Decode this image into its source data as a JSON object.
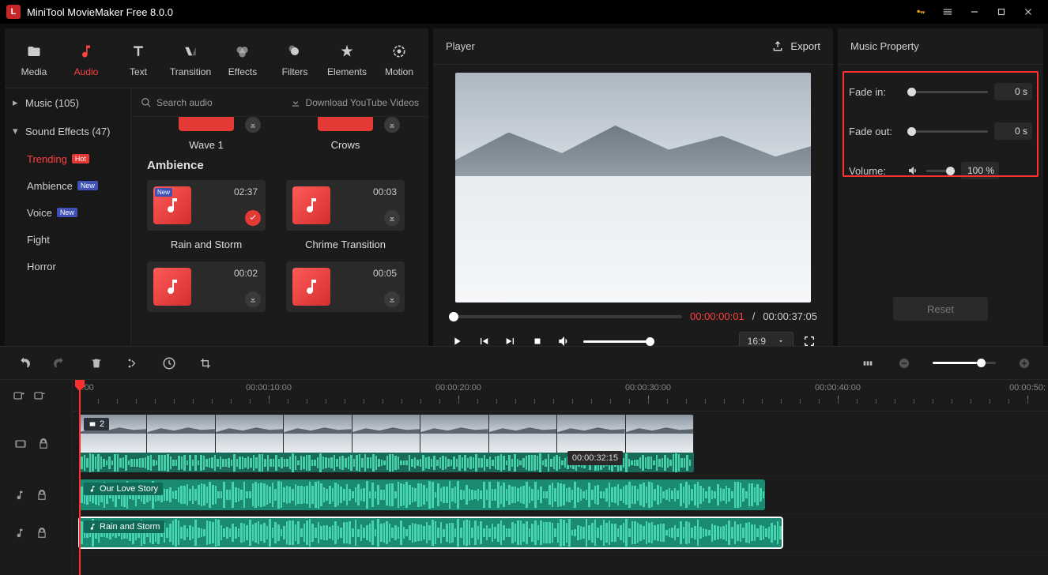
{
  "app": {
    "title": "MiniTool MovieMaker Free 8.0.0"
  },
  "tool_tabs": [
    {
      "id": "media",
      "label": "Media"
    },
    {
      "id": "audio",
      "label": "Audio"
    },
    {
      "id": "text",
      "label": "Text"
    },
    {
      "id": "transition",
      "label": "Transition"
    },
    {
      "id": "effects",
      "label": "Effects"
    },
    {
      "id": "filters",
      "label": "Filters"
    },
    {
      "id": "elements",
      "label": "Elements"
    },
    {
      "id": "motion",
      "label": "Motion"
    }
  ],
  "library": {
    "search_placeholder": "Search audio",
    "youtube_link": "Download YouTube Videos",
    "sections": {
      "music": "Music (105)",
      "sound_effects": "Sound Effects (47)"
    },
    "categories": [
      {
        "id": "trending",
        "label": "Trending",
        "badge": "Hot"
      },
      {
        "id": "ambience",
        "label": "Ambience",
        "badge": "New"
      },
      {
        "id": "voice",
        "label": "Voice",
        "badge": "New"
      },
      {
        "id": "fight",
        "label": "Fight"
      },
      {
        "id": "horror",
        "label": "Horror"
      }
    ],
    "partial_row": [
      {
        "name": "Wave 1"
      },
      {
        "name": "Crows"
      }
    ],
    "group_title": "Ambience",
    "items_row1": [
      {
        "name": "Rain and Storm",
        "duration": "02:37",
        "new": true,
        "checked": true
      },
      {
        "name": "Chrime Transition",
        "duration": "00:03"
      }
    ],
    "items_row2": [
      {
        "name": "",
        "duration": "00:02"
      },
      {
        "name": "",
        "duration": "00:05"
      }
    ]
  },
  "player": {
    "title": "Player",
    "export": "Export",
    "current": "00:00:00:01",
    "total": "00:00:37:05",
    "aspect": "16:9"
  },
  "property": {
    "title": "Music Property",
    "fade_in_label": "Fade in:",
    "fade_in_value": "0 s",
    "fade_out_label": "Fade out:",
    "fade_out_value": "0 s",
    "volume_label": "Volume:",
    "volume_value": "100 %",
    "reset": "Reset"
  },
  "timeline": {
    "ruler_start": "0:00",
    "ruler_marks": [
      "00:00:10:00",
      "00:00:20:00",
      "00:00:30:00",
      "00:00:40:00",
      "00:00:50:"
    ],
    "video_clip": {
      "badge": "2",
      "tooltip": "00:00:32:15"
    },
    "audio1": {
      "label": "Our Love Story"
    },
    "audio2": {
      "label": "Rain and Storm"
    }
  }
}
